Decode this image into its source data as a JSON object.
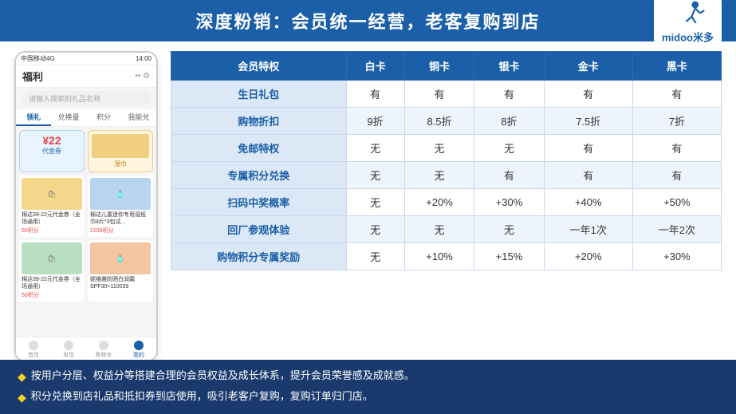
{
  "header": {
    "title": "深度粉销：会员统一经营，老客复购到店",
    "logo_text": "midoo米多"
  },
  "phone": {
    "status_bar": {
      "left": "中国移动4G",
      "right": "14:00"
    },
    "header_title": "福利",
    "search_placeholder": "请输入搜索的礼品名称",
    "tabs": [
      "领礼",
      "兑换量",
      "积分",
      "我能兑"
    ],
    "active_tab": "领礼",
    "coupon1": {
      "amount": "¥22",
      "desc": "代金券"
    },
    "coupon2_desc": "湿巾",
    "product1_desc": "棉达39-22元代金券（全场通用）",
    "product1_points": "50积分",
    "product2_desc": "棉达儿童迷你专用湿纸巾8片*3包试...",
    "product2_points": "2100积分",
    "product3_desc": "棉达39-22元代金券（全场通用）",
    "product3_points": "50积分",
    "product4_desc": "妮维雅防晒白润霜 SPF30+110039",
    "product4_points": "",
    "bottom_nav": [
      "首页",
      "发现",
      "购物车",
      "我的"
    ],
    "active_nav": "我的"
  },
  "table": {
    "headers": [
      "会员特权",
      "白卡",
      "铜卡",
      "银卡",
      "金卡",
      "黑卡"
    ],
    "rows": [
      {
        "feature": "生日礼包",
        "bai": "有",
        "tong": "有",
        "yin": "有",
        "jin": "有",
        "hei": "有"
      },
      {
        "feature": "购物折扣",
        "bai": "9折",
        "tong": "8.5折",
        "yin": "8折",
        "jin": "7.5折",
        "hei": "7折"
      },
      {
        "feature": "免邮特权",
        "bai": "无",
        "tong": "无",
        "yin": "无",
        "jin": "有",
        "hei": "有"
      },
      {
        "feature": "专属积分兑换",
        "bai": "无",
        "tong": "无",
        "yin": "有",
        "jin": "有",
        "hei": "有"
      },
      {
        "feature": "扫码中奖概率",
        "bai": "无",
        "tong": "+20%",
        "yin": "+30%",
        "jin": "+40%",
        "hei": "+50%"
      },
      {
        "feature": "回厂参观体验",
        "bai": "无",
        "tong": "无",
        "yin": "无",
        "jin": "一年1次",
        "hei": "一年2次"
      },
      {
        "feature": "购物积分专属奖励",
        "bai": "无",
        "tong": "+10%",
        "yin": "+15%",
        "jin": "+20%",
        "hei": "+30%"
      }
    ]
  },
  "footer": {
    "lines": [
      "按用户分层、权益分等搭建合理的会员权益及成长体系，提升会员荣誉感及成就感。",
      "积分兑换到店礼品和抵扣券到店使用，吸引老客户复购，复购订单归门店。"
    ]
  }
}
